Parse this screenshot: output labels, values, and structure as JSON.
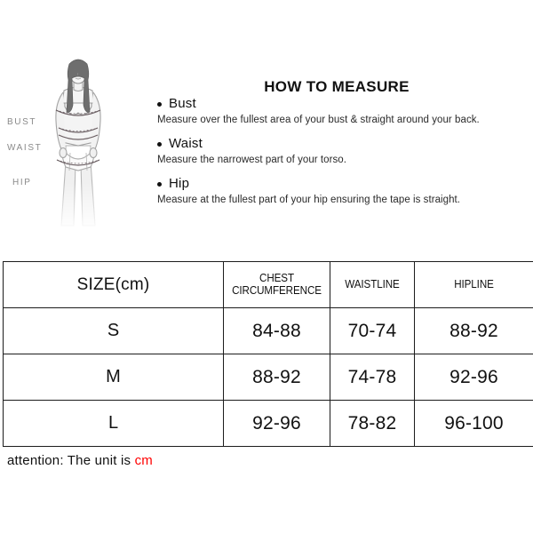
{
  "figure": {
    "labels": {
      "bust": "BUST",
      "waist": "WAIST",
      "hip": "HIP"
    }
  },
  "measure": {
    "title": "HOW TO MEASURE",
    "items": [
      {
        "name": "Bust",
        "description": "Measure over the fullest area of your bust & straight around your back."
      },
      {
        "name": "Waist",
        "description": "Measure the narrowest part of your torso."
      },
      {
        "name": "Hip",
        "description": "Measure at the fullest part of your hip ensuring the tape is straight."
      }
    ]
  },
  "table": {
    "headers": {
      "size": "SIZE(cm)",
      "chest_line1": "CHEST",
      "chest_line2": "CIRCUMFERENCE",
      "waistline": "WAISTLINE",
      "hipline": "HIPLINE"
    },
    "rows": [
      {
        "size": "S",
        "chest": "84-88",
        "waist": "70-74",
        "hip": "88-92"
      },
      {
        "size": "M",
        "chest": "88-92",
        "waist": "74-78",
        "hip": "92-96"
      },
      {
        "size": "L",
        "chest": "92-96",
        "waist": "78-82",
        "hip": "96-100"
      }
    ]
  },
  "attention": {
    "prefix": "attention:  The unit is ",
    "unit": "cm",
    "unit_color": "#ff0000"
  }
}
